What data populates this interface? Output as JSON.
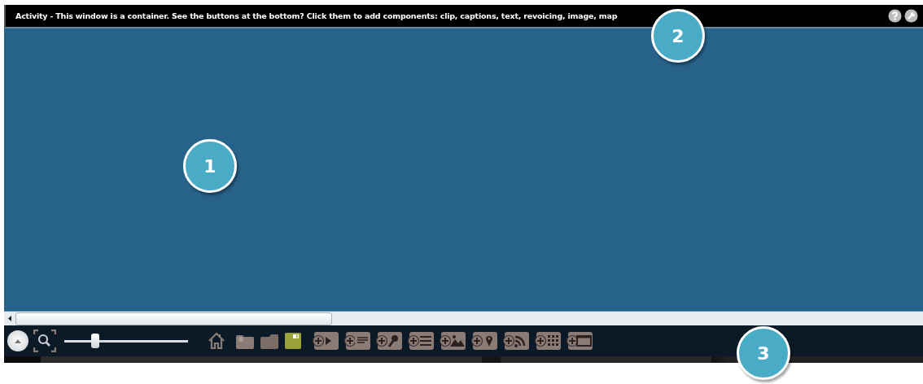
{
  "window": {
    "title": "Activity - This window is a container. See the buttons at the bottom? Click them to add components: clip, captions, text, revoicing, image, map"
  },
  "zoom_slider": {
    "level": 0.25
  },
  "callouts": [
    {
      "label": "1"
    },
    {
      "label": "2"
    },
    {
      "label": "3"
    }
  ]
}
